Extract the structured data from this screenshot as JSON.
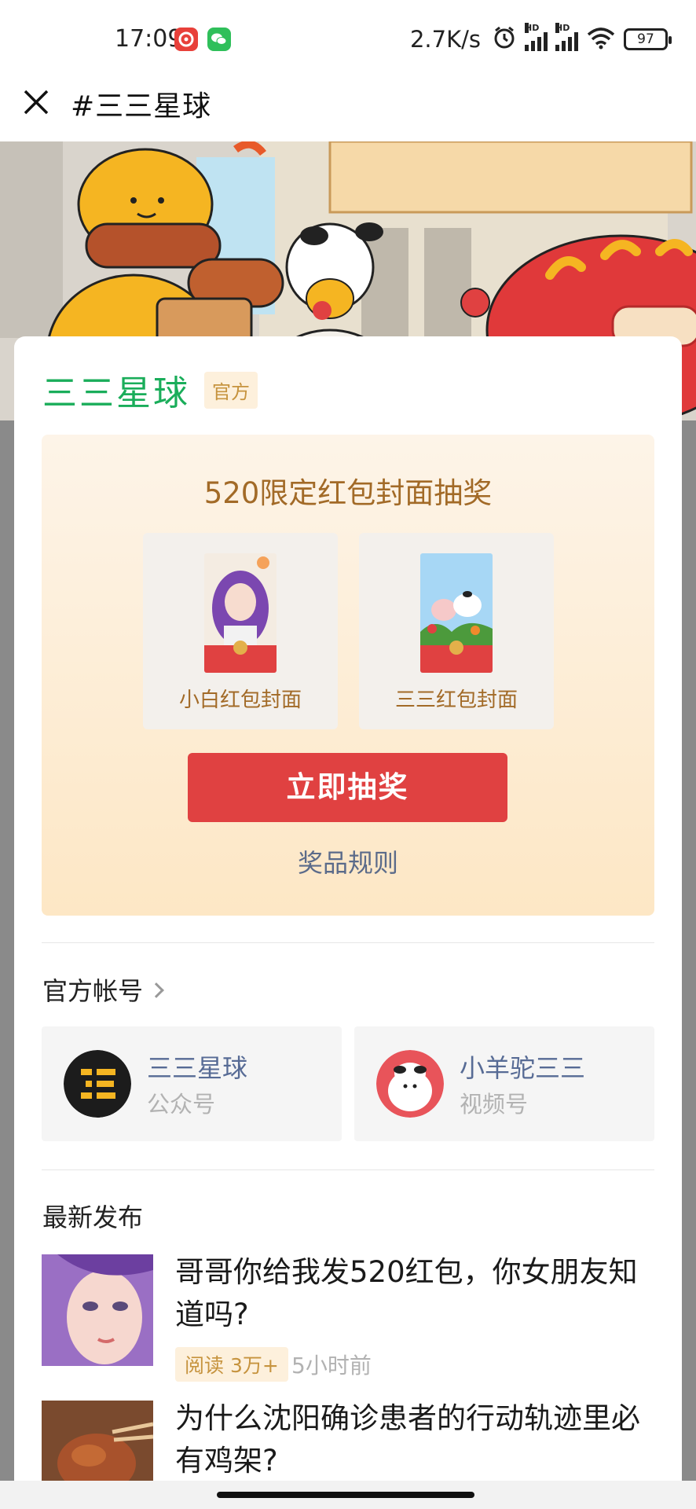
{
  "status_bar": {
    "time": "17:09",
    "net_speed": "2.7K/s",
    "hd_label": "HD",
    "battery": "97",
    "icons": [
      "netease-music-icon",
      "wechat-icon",
      "alarm-icon",
      "signal-icon",
      "wifi-icon",
      "battery-icon"
    ]
  },
  "nav": {
    "title": "#三三星球",
    "close_icon": "close-icon"
  },
  "brand": {
    "name": "三三星球",
    "tag": "官方"
  },
  "lottery": {
    "title": "520限定红包封面抽奖",
    "covers": [
      {
        "label": "小白红包封面"
      },
      {
        "label": "三三红包封面"
      }
    ],
    "button": "立即抽奖",
    "rules_link": "奖品规则"
  },
  "official_accounts": {
    "title": "官方帐号",
    "items": [
      {
        "name": "三三星球",
        "type": "公众号"
      },
      {
        "name": "小羊驼三三",
        "type": "视频号"
      }
    ]
  },
  "latest": {
    "title": "最新发布",
    "articles": [
      {
        "title": "哥哥你给我发520红包，你女朋友知道吗?",
        "reads": "阅读 3万+",
        "time": "5小时前"
      },
      {
        "title": "为什么沈阳确诊患者的行动轨迹里必有鸡架?"
      }
    ]
  },
  "colors": {
    "brand_green": "#1aad5a",
    "button_red": "#e04141",
    "link_blue": "#576b95",
    "gold_text": "#a26a27"
  }
}
